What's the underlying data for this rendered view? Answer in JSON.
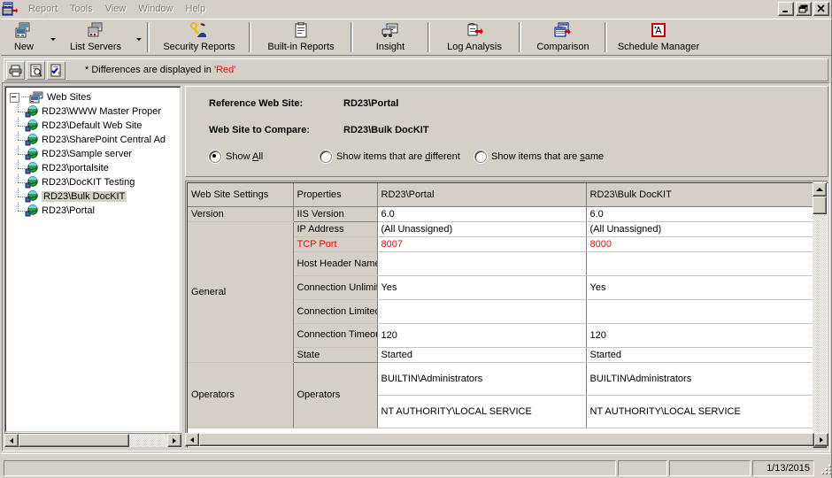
{
  "window": {
    "app_icon": "app-report-icon",
    "minimize_label": "_",
    "restore_label": "Restore",
    "close_label": "X"
  },
  "menu": {
    "items": [
      {
        "label": "Report"
      },
      {
        "label": "Tools"
      },
      {
        "label": "View"
      },
      {
        "label": "Window"
      },
      {
        "label": "Help"
      }
    ]
  },
  "toolbar": {
    "buttons": [
      {
        "label": "New",
        "icon": "new-server-icon",
        "has_dropdown": true
      },
      {
        "label": "List Servers",
        "icon": "list-servers-icon",
        "has_dropdown": true
      },
      {
        "label": "Security Reports",
        "icon": "security-reports-icon",
        "has_dropdown": false
      },
      {
        "label": "Built-in Reports",
        "icon": "built-in-reports-icon",
        "has_dropdown": false
      },
      {
        "label": "Insight",
        "icon": "insight-icon",
        "has_dropdown": false
      },
      {
        "label": "Log Analysis",
        "icon": "log-analysis-icon",
        "has_dropdown": false
      },
      {
        "label": "Comparison",
        "icon": "comparison-icon",
        "has_dropdown": false
      },
      {
        "label": "Schedule Manager",
        "icon": "schedule-manager-icon",
        "has_dropdown": false
      }
    ]
  },
  "subtoolbar": {
    "buttons": [
      {
        "icon": "print-icon"
      },
      {
        "icon": "print-preview-icon"
      },
      {
        "icon": "export-icon"
      }
    ],
    "note_prefix": "* Differences are displayed in ",
    "note_highlight": "'Red'",
    "note_color": "#ff0000"
  },
  "tree": {
    "root": {
      "label": "Web Sites",
      "icon": "web-sites-root-icon",
      "expanded": true
    },
    "items": [
      {
        "label": "RD23\\WWW Master Proper",
        "icon": "web-site-icon",
        "selected": false
      },
      {
        "label": "RD23\\Default Web Site",
        "icon": "web-site-icon",
        "selected": false
      },
      {
        "label": "RD23\\SharePoint Central Ad",
        "icon": "web-site-icon",
        "selected": false
      },
      {
        "label": "RD23\\Sample server",
        "icon": "web-site-icon",
        "selected": false
      },
      {
        "label": "RD23\\portalsite",
        "icon": "web-site-icon",
        "selected": false
      },
      {
        "label": "RD23\\DocKIT Testing",
        "icon": "web-site-icon",
        "selected": false
      },
      {
        "label": "RD23\\Bulk DocKIT",
        "icon": "web-site-icon",
        "selected": true
      },
      {
        "label": "RD23\\Portal",
        "icon": "web-site-icon",
        "selected": false
      }
    ]
  },
  "comparison": {
    "reference_label": "Reference Web Site:",
    "reference_value": "RD23\\Portal",
    "compare_label": "Web Site to Compare:",
    "compare_value": "RD23\\Bulk DocKIT",
    "filters": [
      {
        "label_pre": "Show ",
        "label_key": "A",
        "label_post": "ll",
        "checked": true
      },
      {
        "label_pre": "Show items that are ",
        "label_key": "d",
        "label_post": "ifferent",
        "checked": false
      },
      {
        "label_pre": "Show items that are ",
        "label_key": "s",
        "label_post": "ame",
        "checked": false
      }
    ]
  },
  "grid": {
    "columns": [
      {
        "label": "Web Site Settings"
      },
      {
        "label": "Properties"
      },
      {
        "label": "RD23\\Portal"
      },
      {
        "label": "RD23\\Bulk DocKIT"
      }
    ],
    "rows": [
      {
        "category": "Version",
        "property": "IIS Version",
        "reference": "6.0",
        "compare": "6.0",
        "different": false
      },
      {
        "category": "General",
        "property": "IP Address",
        "reference": "(All Unassigned)",
        "compare": "(All Unassigned)",
        "different": false
      },
      {
        "category": "",
        "property": "TCP Port",
        "reference": "8007",
        "compare": "8000",
        "different": true
      },
      {
        "category": "",
        "property": "Host Header Name",
        "reference": "",
        "compare": "",
        "different": false
      },
      {
        "category": "",
        "property": "Connection Unlimited",
        "reference": "Yes",
        "compare": "Yes",
        "different": false
      },
      {
        "category": "",
        "property": "Connection Limited",
        "reference": "",
        "compare": "",
        "different": false
      },
      {
        "category": "",
        "property": "Connection Timeout (seconds)",
        "reference": "120",
        "compare": "120",
        "different": false
      },
      {
        "category": "",
        "property": "State",
        "reference": "Started",
        "compare": "Started",
        "different": false
      },
      {
        "category": "Operators",
        "property": "Operators",
        "reference": "BUILTIN\\Administrators",
        "compare": "BUILTIN\\Administrators",
        "different": false
      },
      {
        "category": "",
        "property": "",
        "reference": "NT AUTHORITY\\LOCAL SERVICE",
        "compare": "NT AUTHORITY\\LOCAL SERVICE",
        "different": false
      }
    ]
  },
  "statusbar": {
    "panel1": "",
    "panel2": "",
    "panel3": "",
    "date": "1/13/2015"
  },
  "colors": {
    "face": "#d4d0c8",
    "diff_red": "#ff0000",
    "selection": "#d4d0c8"
  }
}
